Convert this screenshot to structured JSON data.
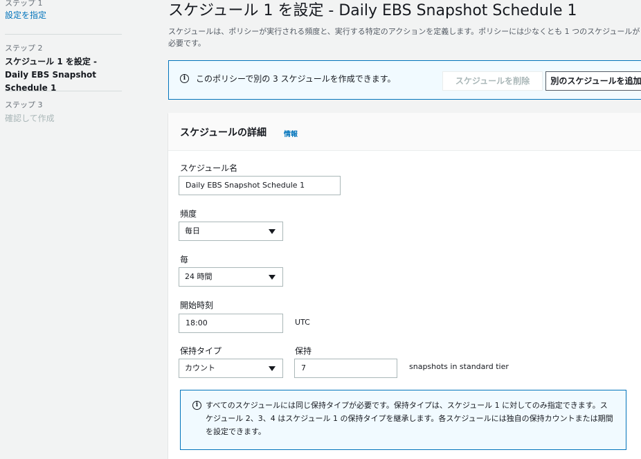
{
  "sidebar": {
    "steps": [
      {
        "num": "ステップ 1",
        "label": "設定を指定"
      },
      {
        "num": "ステップ 2",
        "label": "スケジュール 1 を設定 - Daily EBS Snapshot Schedule 1"
      },
      {
        "num": "ステップ 3",
        "label": "確認して作成"
      }
    ]
  },
  "header": {
    "title": "スケジュール 1 を設定 - Daily EBS Snapshot Schedule 1",
    "description": "スケジュールは、ポリシーが実行される頻度と、実行する特定のアクションを定義します。ポリシーには少なくとも 1 つのスケジュールが必要です。"
  },
  "banner": {
    "icon": "info-icon",
    "text": "このポリシーで別の 3 スケジュールを作成できます。",
    "delete_button": "スケジュールを削除",
    "add_button": "別のスケジュールを追加"
  },
  "details": {
    "title": "スケジュールの詳細",
    "info_link": "情報",
    "schedule_name_label": "スケジュール名",
    "schedule_name_value": "Daily EBS Snapshot Schedule 1",
    "frequency_label": "頻度",
    "frequency_value": "毎日",
    "every_label": "毎",
    "every_value": "24 時間",
    "start_time_label": "開始時刻",
    "start_time_value": "18:00",
    "start_time_suffix": "UTC",
    "retention_type_label": "保持タイプ",
    "retention_type_value": "カウント",
    "retention_label": "保持",
    "retention_value": "7",
    "retention_suffix": "snapshots in standard tier",
    "notice_text": "すべてのスケジュールには同じ保持タイプが必要です。保持タイプは、スケジュール 1 に対してのみ指定できます。スケジュール 2、3、4 はスケジュール 1 の保持タイプを継承します。各スケジュールには独自の保持カウントまたは期間を設定できます。"
  },
  "colors": {
    "link": "#0073bb",
    "background": "#f2f3f3",
    "info_background": "#f1faff"
  }
}
